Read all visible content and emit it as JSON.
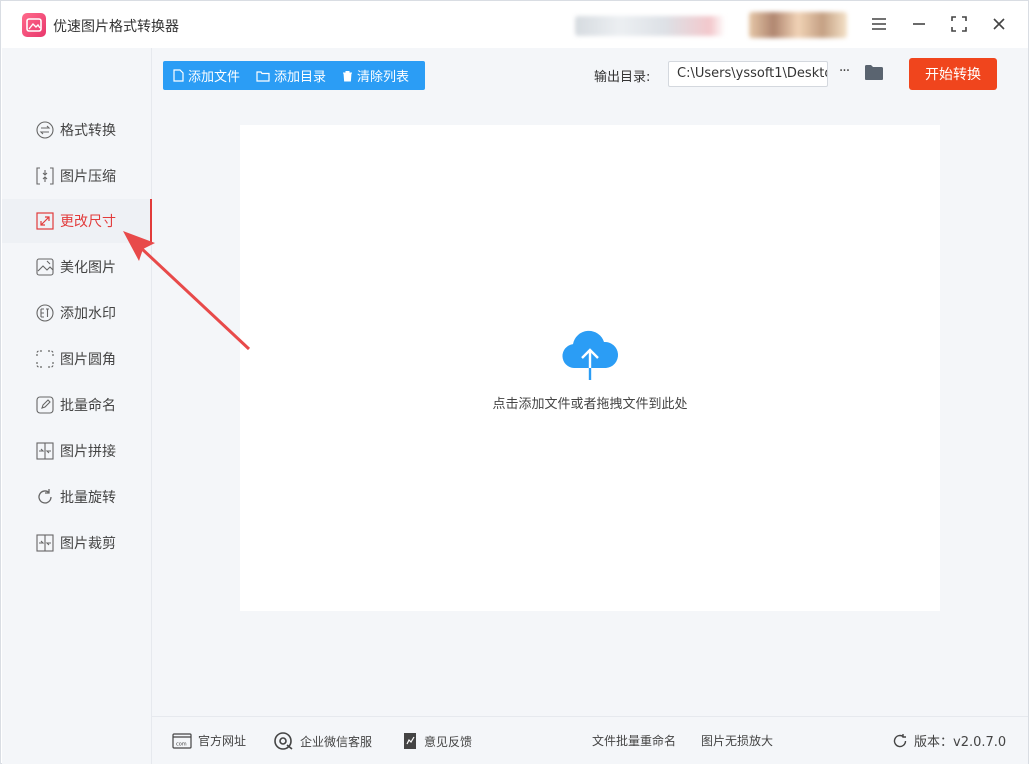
{
  "app": {
    "title": "优速图片格式转换器"
  },
  "window_controls": {
    "menu": "menu-icon",
    "minimize": "minimize-icon",
    "maximize": "maximize-icon",
    "close": "close-icon"
  },
  "sidebar": {
    "items": [
      {
        "label": "格式转换",
        "icon": "convert-icon",
        "active": false
      },
      {
        "label": "图片压缩",
        "icon": "compress-icon",
        "active": false
      },
      {
        "label": "更改尺寸",
        "icon": "resize-icon",
        "active": true
      },
      {
        "label": "美化图片",
        "icon": "beautify-icon",
        "active": false
      },
      {
        "label": "添加水印",
        "icon": "watermark-icon",
        "active": false
      },
      {
        "label": "图片圆角",
        "icon": "round-corner-icon",
        "active": false
      },
      {
        "label": "批量命名",
        "icon": "rename-icon",
        "active": false
      },
      {
        "label": "图片拼接",
        "icon": "stitch-icon",
        "active": false
      },
      {
        "label": "批量旋转",
        "icon": "rotate-icon",
        "active": false
      },
      {
        "label": "图片裁剪",
        "icon": "crop-icon",
        "active": false
      }
    ]
  },
  "toolbar": {
    "add_file": "添加文件",
    "add_folder": "添加目录",
    "clear_list": "清除列表",
    "output_label": "输出目录:",
    "output_path": "C:\\Users\\yssoft1\\Deskto",
    "more": "···",
    "start": "开始转换"
  },
  "dropzone": {
    "hint": "点击添加文件或者拖拽文件到此处"
  },
  "footer": {
    "website": "官方网址",
    "wechat": "企业微信客服",
    "feedback": "意见反馈",
    "batch_rename": "文件批量重命名",
    "lossless_zoom": "图片无损放大",
    "version": "版本：v2.0.7.0"
  },
  "colors": {
    "accent": "#2b9df5",
    "start": "#f0451d",
    "active": "#e23b3b"
  }
}
